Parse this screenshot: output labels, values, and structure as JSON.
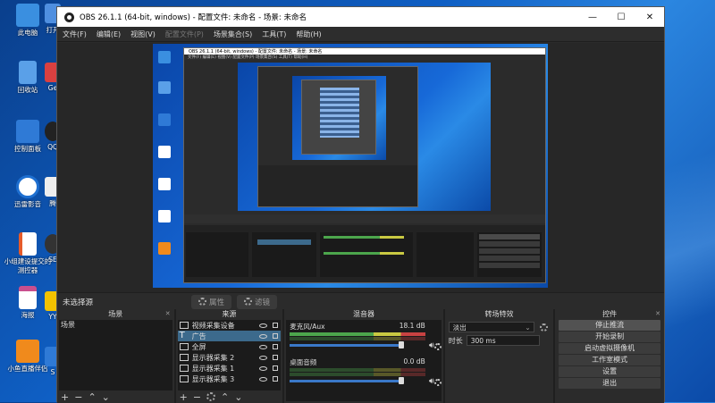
{
  "desktop": {
    "icons": [
      {
        "label": "此电脑",
        "color": "#3a8fe0"
      },
      {
        "label": "回收站",
        "color": "#5aa0e8"
      },
      {
        "label": "控制面板",
        "color": "#2f7ad6"
      },
      {
        "label": "迅雷影音",
        "color": "#1e6fd0"
      },
      {
        "label": "小组建设提交的测控器",
        "color": "#e65b2a"
      },
      {
        "label": "海报",
        "color": "#c94f8e"
      },
      {
        "label": "小鱼直播伴侣",
        "color": "#f08a1c"
      }
    ],
    "peek_labels": [
      "打开",
      "Ge",
      "QQ",
      "腾",
      "SE",
      "YY",
      "S"
    ]
  },
  "window": {
    "title": "OBS 26.1.1 (64-bit, windows) - 配置文件: 未命名 - 场景: 未命名",
    "controls": [
      "—",
      "☐",
      "✕"
    ]
  },
  "menu": [
    {
      "label": "文件(F)",
      "enabled": true
    },
    {
      "label": "编辑(E)",
      "enabled": true
    },
    {
      "label": "视图(V)",
      "enabled": true
    },
    {
      "label": "配置文件(P)",
      "enabled": false
    },
    {
      "label": "场景集合(S)",
      "enabled": true
    },
    {
      "label": "工具(T)",
      "enabled": true
    },
    {
      "label": "帮助(H)",
      "enabled": true
    }
  ],
  "status": {
    "no_source": "未选择源",
    "properties": "属性",
    "filters": "滤镜"
  },
  "scenes": {
    "title": "场景",
    "items": [
      "场景"
    ]
  },
  "sources": {
    "title": "来源",
    "items": [
      {
        "label": "视频采集设备",
        "icon": "camera-icon",
        "selected": false
      },
      {
        "label": "广告",
        "icon": "text-icon",
        "selected": true
      },
      {
        "label": "全屏",
        "icon": "monitor-icon",
        "selected": false
      },
      {
        "label": "显示器采集 2",
        "icon": "monitor-icon",
        "selected": false
      },
      {
        "label": "显示器采集 1",
        "icon": "monitor-icon",
        "selected": false
      },
      {
        "label": "显示器采集 3",
        "icon": "monitor-icon",
        "selected": false
      }
    ]
  },
  "mixer": {
    "title": "混音器",
    "channels": [
      {
        "name": "麦克风/Aux",
        "db": "18.1 dB"
      },
      {
        "name": "桌面音频",
        "db": "0.0 dB"
      }
    ]
  },
  "transitions": {
    "title": "转场特效",
    "selected": "淡出",
    "duration_label": "时长",
    "duration_value": "300 ms"
  },
  "controls": {
    "title": "控件",
    "buttons": [
      "停止推流",
      "开始录制",
      "启动虚拟摄像机",
      "工作室模式",
      "设置",
      "退出"
    ]
  },
  "nested": {
    "title": "OBS 26.1.1 (64-bit, windows) - 配置文件: 未命名 - 场景: 未命名",
    "menu": "文件(F)  编辑(E)  视图(V)  配置文件(P)  场景集合(S)  工具(T)  帮助(H)"
  }
}
